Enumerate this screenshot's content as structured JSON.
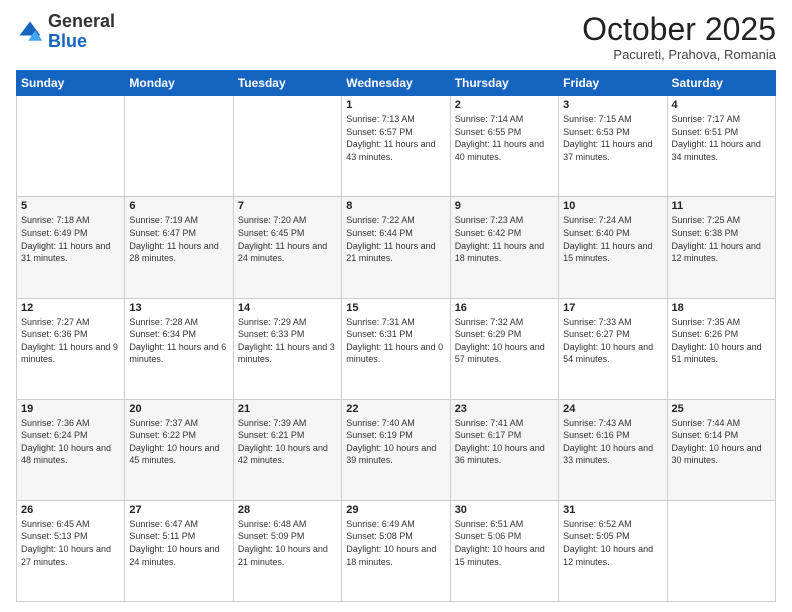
{
  "header": {
    "logo_general": "General",
    "logo_blue": "Blue",
    "month_title": "October 2025",
    "location": "Pacureti, Prahova, Romania"
  },
  "days_of_week": [
    "Sunday",
    "Monday",
    "Tuesday",
    "Wednesday",
    "Thursday",
    "Friday",
    "Saturday"
  ],
  "weeks": [
    [
      {
        "num": "",
        "info": ""
      },
      {
        "num": "",
        "info": ""
      },
      {
        "num": "",
        "info": ""
      },
      {
        "num": "1",
        "info": "Sunrise: 7:13 AM\nSunset: 6:57 PM\nDaylight: 11 hours and 43 minutes."
      },
      {
        "num": "2",
        "info": "Sunrise: 7:14 AM\nSunset: 6:55 PM\nDaylight: 11 hours and 40 minutes."
      },
      {
        "num": "3",
        "info": "Sunrise: 7:15 AM\nSunset: 6:53 PM\nDaylight: 11 hours and 37 minutes."
      },
      {
        "num": "4",
        "info": "Sunrise: 7:17 AM\nSunset: 6:51 PM\nDaylight: 11 hours and 34 minutes."
      }
    ],
    [
      {
        "num": "5",
        "info": "Sunrise: 7:18 AM\nSunset: 6:49 PM\nDaylight: 11 hours and 31 minutes."
      },
      {
        "num": "6",
        "info": "Sunrise: 7:19 AM\nSunset: 6:47 PM\nDaylight: 11 hours and 28 minutes."
      },
      {
        "num": "7",
        "info": "Sunrise: 7:20 AM\nSunset: 6:45 PM\nDaylight: 11 hours and 24 minutes."
      },
      {
        "num": "8",
        "info": "Sunrise: 7:22 AM\nSunset: 6:44 PM\nDaylight: 11 hours and 21 minutes."
      },
      {
        "num": "9",
        "info": "Sunrise: 7:23 AM\nSunset: 6:42 PM\nDaylight: 11 hours and 18 minutes."
      },
      {
        "num": "10",
        "info": "Sunrise: 7:24 AM\nSunset: 6:40 PM\nDaylight: 11 hours and 15 minutes."
      },
      {
        "num": "11",
        "info": "Sunrise: 7:25 AM\nSunset: 6:38 PM\nDaylight: 11 hours and 12 minutes."
      }
    ],
    [
      {
        "num": "12",
        "info": "Sunrise: 7:27 AM\nSunset: 6:36 PM\nDaylight: 11 hours and 9 minutes."
      },
      {
        "num": "13",
        "info": "Sunrise: 7:28 AM\nSunset: 6:34 PM\nDaylight: 11 hours and 6 minutes."
      },
      {
        "num": "14",
        "info": "Sunrise: 7:29 AM\nSunset: 6:33 PM\nDaylight: 11 hours and 3 minutes."
      },
      {
        "num": "15",
        "info": "Sunrise: 7:31 AM\nSunset: 6:31 PM\nDaylight: 11 hours and 0 minutes."
      },
      {
        "num": "16",
        "info": "Sunrise: 7:32 AM\nSunset: 6:29 PM\nDaylight: 10 hours and 57 minutes."
      },
      {
        "num": "17",
        "info": "Sunrise: 7:33 AM\nSunset: 6:27 PM\nDaylight: 10 hours and 54 minutes."
      },
      {
        "num": "18",
        "info": "Sunrise: 7:35 AM\nSunset: 6:26 PM\nDaylight: 10 hours and 51 minutes."
      }
    ],
    [
      {
        "num": "19",
        "info": "Sunrise: 7:36 AM\nSunset: 6:24 PM\nDaylight: 10 hours and 48 minutes."
      },
      {
        "num": "20",
        "info": "Sunrise: 7:37 AM\nSunset: 6:22 PM\nDaylight: 10 hours and 45 minutes."
      },
      {
        "num": "21",
        "info": "Sunrise: 7:39 AM\nSunset: 6:21 PM\nDaylight: 10 hours and 42 minutes."
      },
      {
        "num": "22",
        "info": "Sunrise: 7:40 AM\nSunset: 6:19 PM\nDaylight: 10 hours and 39 minutes."
      },
      {
        "num": "23",
        "info": "Sunrise: 7:41 AM\nSunset: 6:17 PM\nDaylight: 10 hours and 36 minutes."
      },
      {
        "num": "24",
        "info": "Sunrise: 7:43 AM\nSunset: 6:16 PM\nDaylight: 10 hours and 33 minutes."
      },
      {
        "num": "25",
        "info": "Sunrise: 7:44 AM\nSunset: 6:14 PM\nDaylight: 10 hours and 30 minutes."
      }
    ],
    [
      {
        "num": "26",
        "info": "Sunrise: 6:45 AM\nSunset: 5:13 PM\nDaylight: 10 hours and 27 minutes."
      },
      {
        "num": "27",
        "info": "Sunrise: 6:47 AM\nSunset: 5:11 PM\nDaylight: 10 hours and 24 minutes."
      },
      {
        "num": "28",
        "info": "Sunrise: 6:48 AM\nSunset: 5:09 PM\nDaylight: 10 hours and 21 minutes."
      },
      {
        "num": "29",
        "info": "Sunrise: 6:49 AM\nSunset: 5:08 PM\nDaylight: 10 hours and 18 minutes."
      },
      {
        "num": "30",
        "info": "Sunrise: 6:51 AM\nSunset: 5:06 PM\nDaylight: 10 hours and 15 minutes."
      },
      {
        "num": "31",
        "info": "Sunrise: 6:52 AM\nSunset: 5:05 PM\nDaylight: 10 hours and 12 minutes."
      },
      {
        "num": "",
        "info": ""
      }
    ]
  ]
}
